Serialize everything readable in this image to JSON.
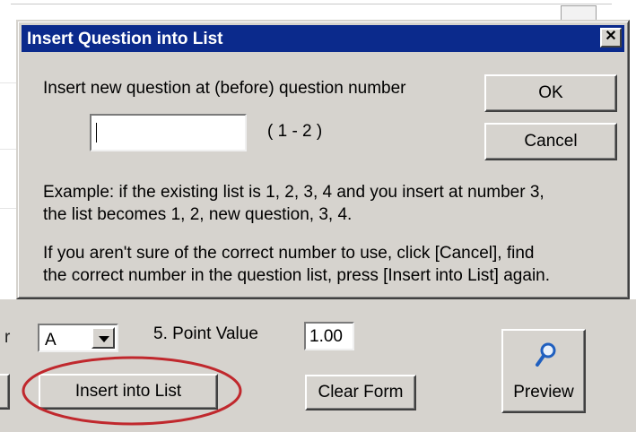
{
  "dialog": {
    "title": "Insert Question into List",
    "close_glyph": "✕",
    "prompt": "Insert new question at (before) question number",
    "input_value": "",
    "range": "( 1 - 2 )",
    "ok_label": "OK",
    "cancel_label": "Cancel",
    "example_line1": "Example:  if the existing list is 1, 2, 3, 4 and you insert at number 3,",
    "example_line2": "the list becomes  1, 2, new question, 3, 4.",
    "advice_line1": "If you aren't sure of the correct number to use, click [Cancel], find",
    "advice_line2": "the correct number in the question list, press [Insert into List] again."
  },
  "form": {
    "edge_char": "r",
    "answer_select_value": "A",
    "point_value_label": "5.  Point Value",
    "point_value": "1.00",
    "insert_button_label": "Insert into List",
    "clear_button_label": "Clear Form",
    "preview_button_label": "Preview"
  },
  "icons": {
    "preview": "magnifier-icon",
    "dropdown": "chevron-down-icon",
    "close": "close-icon"
  },
  "colors": {
    "titlebar": "#0b2a8c",
    "face": "#d6d3ce",
    "highlight_ellipse": "#c0282d",
    "magnifier": "#1f5fbf"
  }
}
